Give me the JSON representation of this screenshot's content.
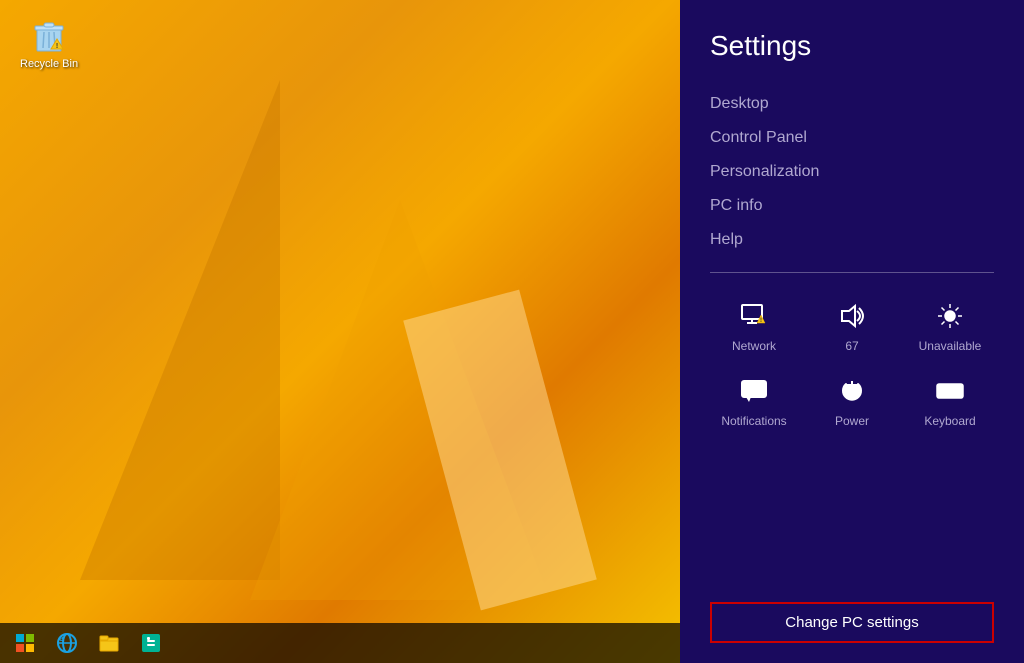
{
  "desktop": {
    "recycle_bin": {
      "label": "Recycle Bin"
    }
  },
  "taskbar": {
    "start_label": "Start",
    "ie_label": "Internet Explorer",
    "file_explorer_label": "File Explorer",
    "store_label": "Store"
  },
  "settings": {
    "title": "Settings",
    "menu_items": [
      {
        "id": "desktop",
        "label": "Desktop"
      },
      {
        "id": "control-panel",
        "label": "Control Panel"
      },
      {
        "id": "personalization",
        "label": "Personalization"
      },
      {
        "id": "pc-info",
        "label": "PC info"
      },
      {
        "id": "help",
        "label": "Help"
      }
    ],
    "quick_items": [
      {
        "id": "network",
        "label": "Network",
        "value": ""
      },
      {
        "id": "volume",
        "label": "67",
        "value": "67"
      },
      {
        "id": "brightness",
        "label": "Unavailable",
        "value": ""
      },
      {
        "id": "notifications",
        "label": "Notifications",
        "value": ""
      },
      {
        "id": "power",
        "label": "Power",
        "value": ""
      },
      {
        "id": "keyboard",
        "label": "Keyboard",
        "value": ""
      }
    ],
    "change_pc_settings_label": "Change PC settings"
  }
}
